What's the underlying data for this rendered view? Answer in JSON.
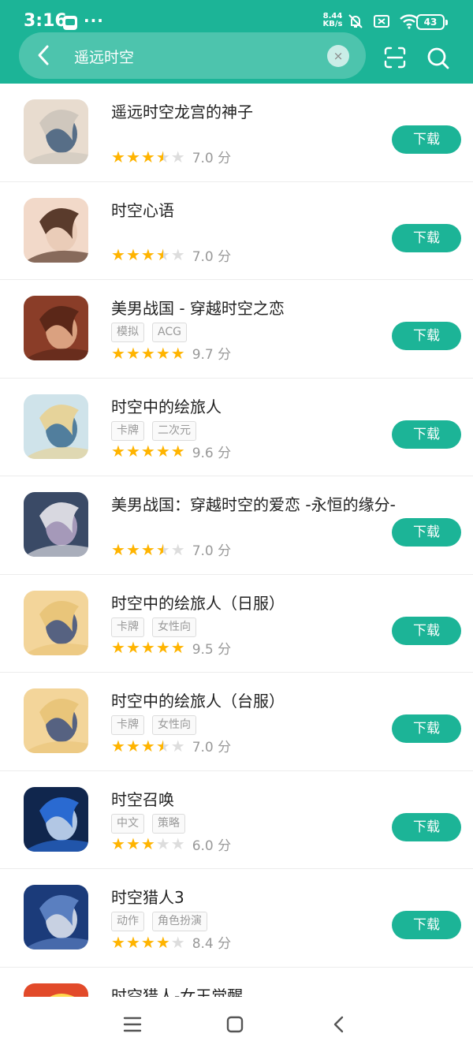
{
  "status_bar": {
    "time": "3:16",
    "dots": "···",
    "net_speed_top": "8.44",
    "net_speed_bottom": "KB/s",
    "battery": "43"
  },
  "search": {
    "query": "遥远时空",
    "clear_glyph": "×"
  },
  "colors": {
    "accent": "#1cb497",
    "star_on": "#ffb400",
    "star_off": "#dddddd"
  },
  "download_label": "下载",
  "apps": [
    {
      "title": "遥远时空龙宫的神子",
      "tags": [],
      "stars": 3.5,
      "rating": "7.0 分"
    },
    {
      "title": "时空心语",
      "tags": [],
      "stars": 3.5,
      "rating": "7.0 分"
    },
    {
      "title": "美男战国 - 穿越时空之恋",
      "tags": [
        "模拟",
        "ACG"
      ],
      "stars": 5,
      "rating": "9.7 分"
    },
    {
      "title": "时空中的绘旅人",
      "tags": [
        "卡牌",
        "二次元"
      ],
      "stars": 5,
      "rating": "9.6 分"
    },
    {
      "title": "美男战国：穿越时空的爱恋 -永恒的缘分-",
      "tags": [],
      "stars": 3.5,
      "rating": "7.0 分"
    },
    {
      "title": "时空中的绘旅人（日服）",
      "tags": [
        "卡牌",
        "女性向"
      ],
      "stars": 5,
      "rating": "9.5 分"
    },
    {
      "title": "时空中的绘旅人（台服）",
      "tags": [
        "卡牌",
        "女性向"
      ],
      "stars": 3.5,
      "rating": "7.0 分"
    },
    {
      "title": "时空召唤",
      "tags": [
        "中文",
        "策略"
      ],
      "stars": 3,
      "rating": "6.0 分"
    },
    {
      "title": "时空猎人3",
      "tags": [
        "动作",
        "角色扮演"
      ],
      "stars": 4,
      "rating": "8.4 分"
    },
    {
      "title": "时空猎人-女王觉醒",
      "tags": [],
      "stars": 0,
      "rating": ""
    }
  ]
}
